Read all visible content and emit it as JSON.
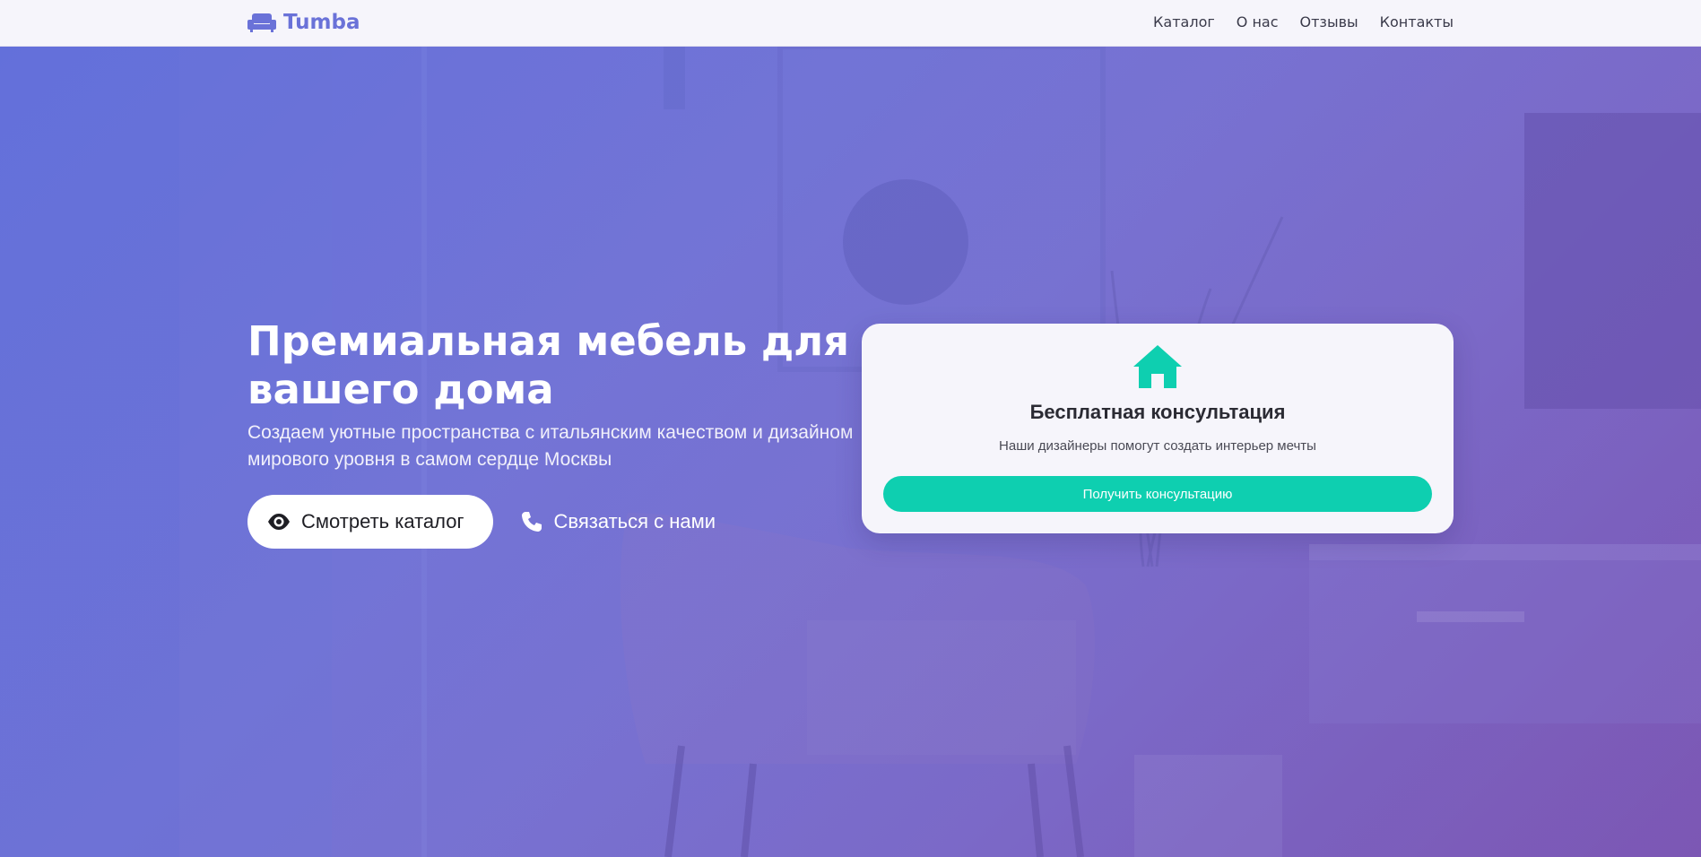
{
  "brand": {
    "name": "Tumba",
    "icon": "sofa-icon",
    "color": "#6a72d8"
  },
  "nav": {
    "items": [
      {
        "label": "Каталог"
      },
      {
        "label": "О нас"
      },
      {
        "label": "Отзывы"
      },
      {
        "label": "Контакты"
      }
    ]
  },
  "hero": {
    "title": "Премиальная мебель для вашего дома",
    "subtitle": "Создаем уютные пространства с итальянским качеством и дизайном мирового уровня в самом сердце Москвы",
    "primary_button": {
      "label": "Смотреть каталог",
      "icon": "eye-icon"
    },
    "secondary_button": {
      "label": "Связаться с нами",
      "icon": "phone-icon"
    }
  },
  "consult_card": {
    "icon": "home-icon",
    "title": "Бесплатная консультация",
    "description": "Наши дизайнеры помогут создать интерьер мечты",
    "button_label": "Получить консультацию",
    "accent_color": "#0ecfb0"
  }
}
